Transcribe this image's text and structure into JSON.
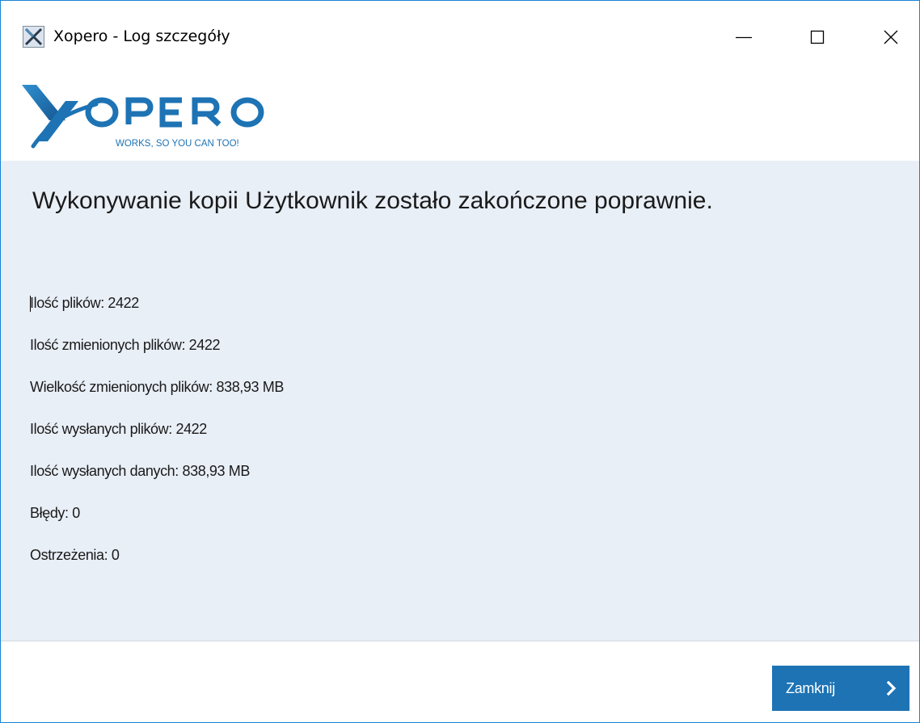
{
  "window": {
    "title": "Xopero - Log szczegóły",
    "controls": {
      "minimize": "minimize",
      "maximize": "maximize",
      "close": "close"
    }
  },
  "branding": {
    "logo_text": "XOPERO",
    "tagline": "WORKS, SO YOU CAN TOO!",
    "brand_color": "#1d73b4"
  },
  "main": {
    "headline": "Wykonywanie kopii Użytkownik zostało zakończone poprawnie.",
    "stats": [
      "Ilość plików:  2422",
      "Ilość zmienionych plików: 2422",
      "Wielkość zmienionych plików: 838,93 MB",
      "Ilość wysłanych plików: 2422",
      "Ilość wysłanych danych: 838,93 MB",
      "Błędy: 0",
      "Ostrzeżenia: 0"
    ]
  },
  "footer": {
    "close_button_label": "Zamknij",
    "close_button_icon": "chevron-right-icon"
  },
  "colors": {
    "content_background": "#e9eff7",
    "window_border": "#1883d7",
    "button": "#1d73b4"
  }
}
